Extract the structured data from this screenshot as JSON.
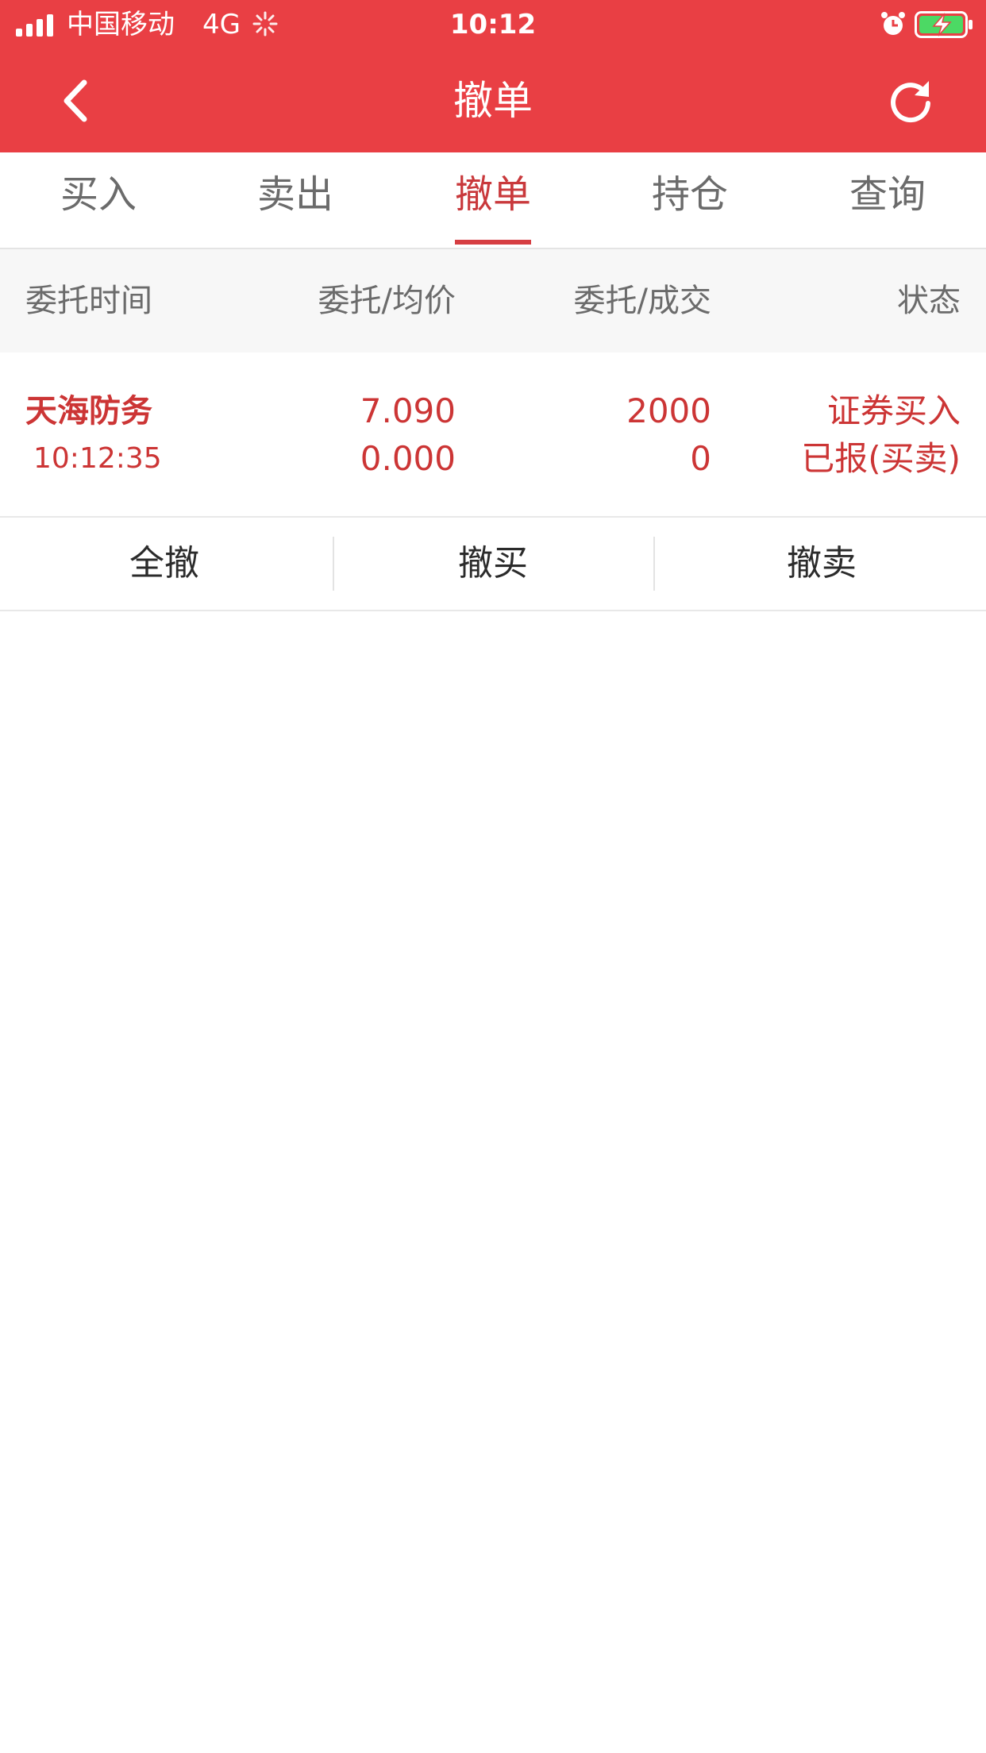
{
  "status_bar": {
    "carrier": "中国移动",
    "network": "4G",
    "time": "10:12"
  },
  "nav": {
    "title": "撤单",
    "back_icon": "chevron-left-icon",
    "refresh_icon": "refresh-icon"
  },
  "tabs": [
    {
      "label": "买入"
    },
    {
      "label": "卖出"
    },
    {
      "label": "撤单",
      "active": true
    },
    {
      "label": "持仓"
    },
    {
      "label": "查询"
    }
  ],
  "columns": [
    "委托时间",
    "委托/均价",
    "委托/成交",
    "状态"
  ],
  "orders": [
    {
      "name": "天海防务",
      "time": "10:12:35",
      "order_price": "7.090",
      "avg_price": "0.000",
      "order_qty": "2000",
      "filled_qty": "0",
      "type": "证券买入",
      "status": "已报(买卖)"
    }
  ],
  "actions": [
    "全撤",
    "撤买",
    "撤卖"
  ],
  "colors": {
    "header_bg": "#e93f44",
    "accent_red": "#cc3535",
    "tab_inactive": "#6b6b6b"
  }
}
